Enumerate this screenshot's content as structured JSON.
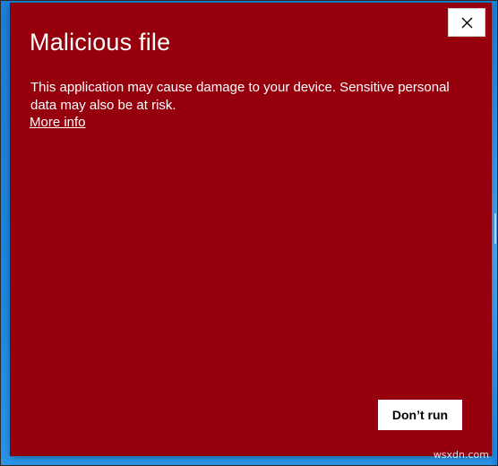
{
  "dialog": {
    "title": "Malicious file",
    "message": "This application may cause damage to your device. Sensitive personal data may also be at risk.",
    "more_info_link": "More info",
    "primary_button": "Don’t run",
    "close_icon": "close-icon",
    "background_color": "#96000c"
  },
  "desktop": {
    "background_color": "#1c86e0",
    "watermark": "wsxdn.com"
  }
}
